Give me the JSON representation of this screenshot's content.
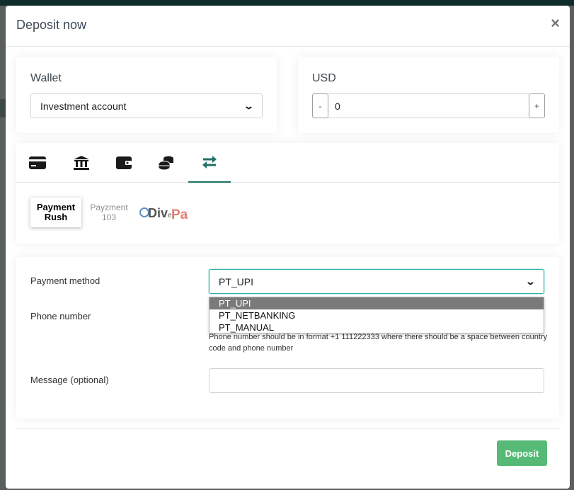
{
  "modal": {
    "title": "Deposit now",
    "close": "×"
  },
  "wallet": {
    "label": "Wallet",
    "selected": "Investment account"
  },
  "amount": {
    "currency": "USD",
    "value": "0",
    "minus": "-",
    "plus": "+"
  },
  "tabs": [
    {
      "icon": "credit-card-icon"
    },
    {
      "icon": "bank-icon"
    },
    {
      "icon": "wallet-icon"
    },
    {
      "icon": "coins-icon"
    },
    {
      "icon": "exchange-arrows-icon",
      "active": true
    }
  ],
  "providers": [
    {
      "line1": "Payment",
      "line2": "Rush",
      "selected": true
    },
    {
      "line1": "Payzment",
      "line2": "103"
    },
    {
      "logo_text_1": "Div",
      "logo_text_2": "e",
      "logo_text_3": "Pay"
    }
  ],
  "form": {
    "payment_method": {
      "label": "Payment method",
      "selected": "PT_UPI",
      "options": [
        "PT_UPI",
        "PT_NETBANKING",
        "PT_MANUAL"
      ]
    },
    "phone": {
      "label": "Phone number",
      "helper": "Phone number should be in format +1 111222333 where there should be a space between country code and phone number"
    },
    "message": {
      "label": "Message (optional)",
      "value": ""
    }
  },
  "footer": {
    "deposit_label": "Deposit"
  },
  "colors": {
    "accent": "#1e7167",
    "deposit": "#56ba76",
    "focus": "#2db3a6"
  }
}
